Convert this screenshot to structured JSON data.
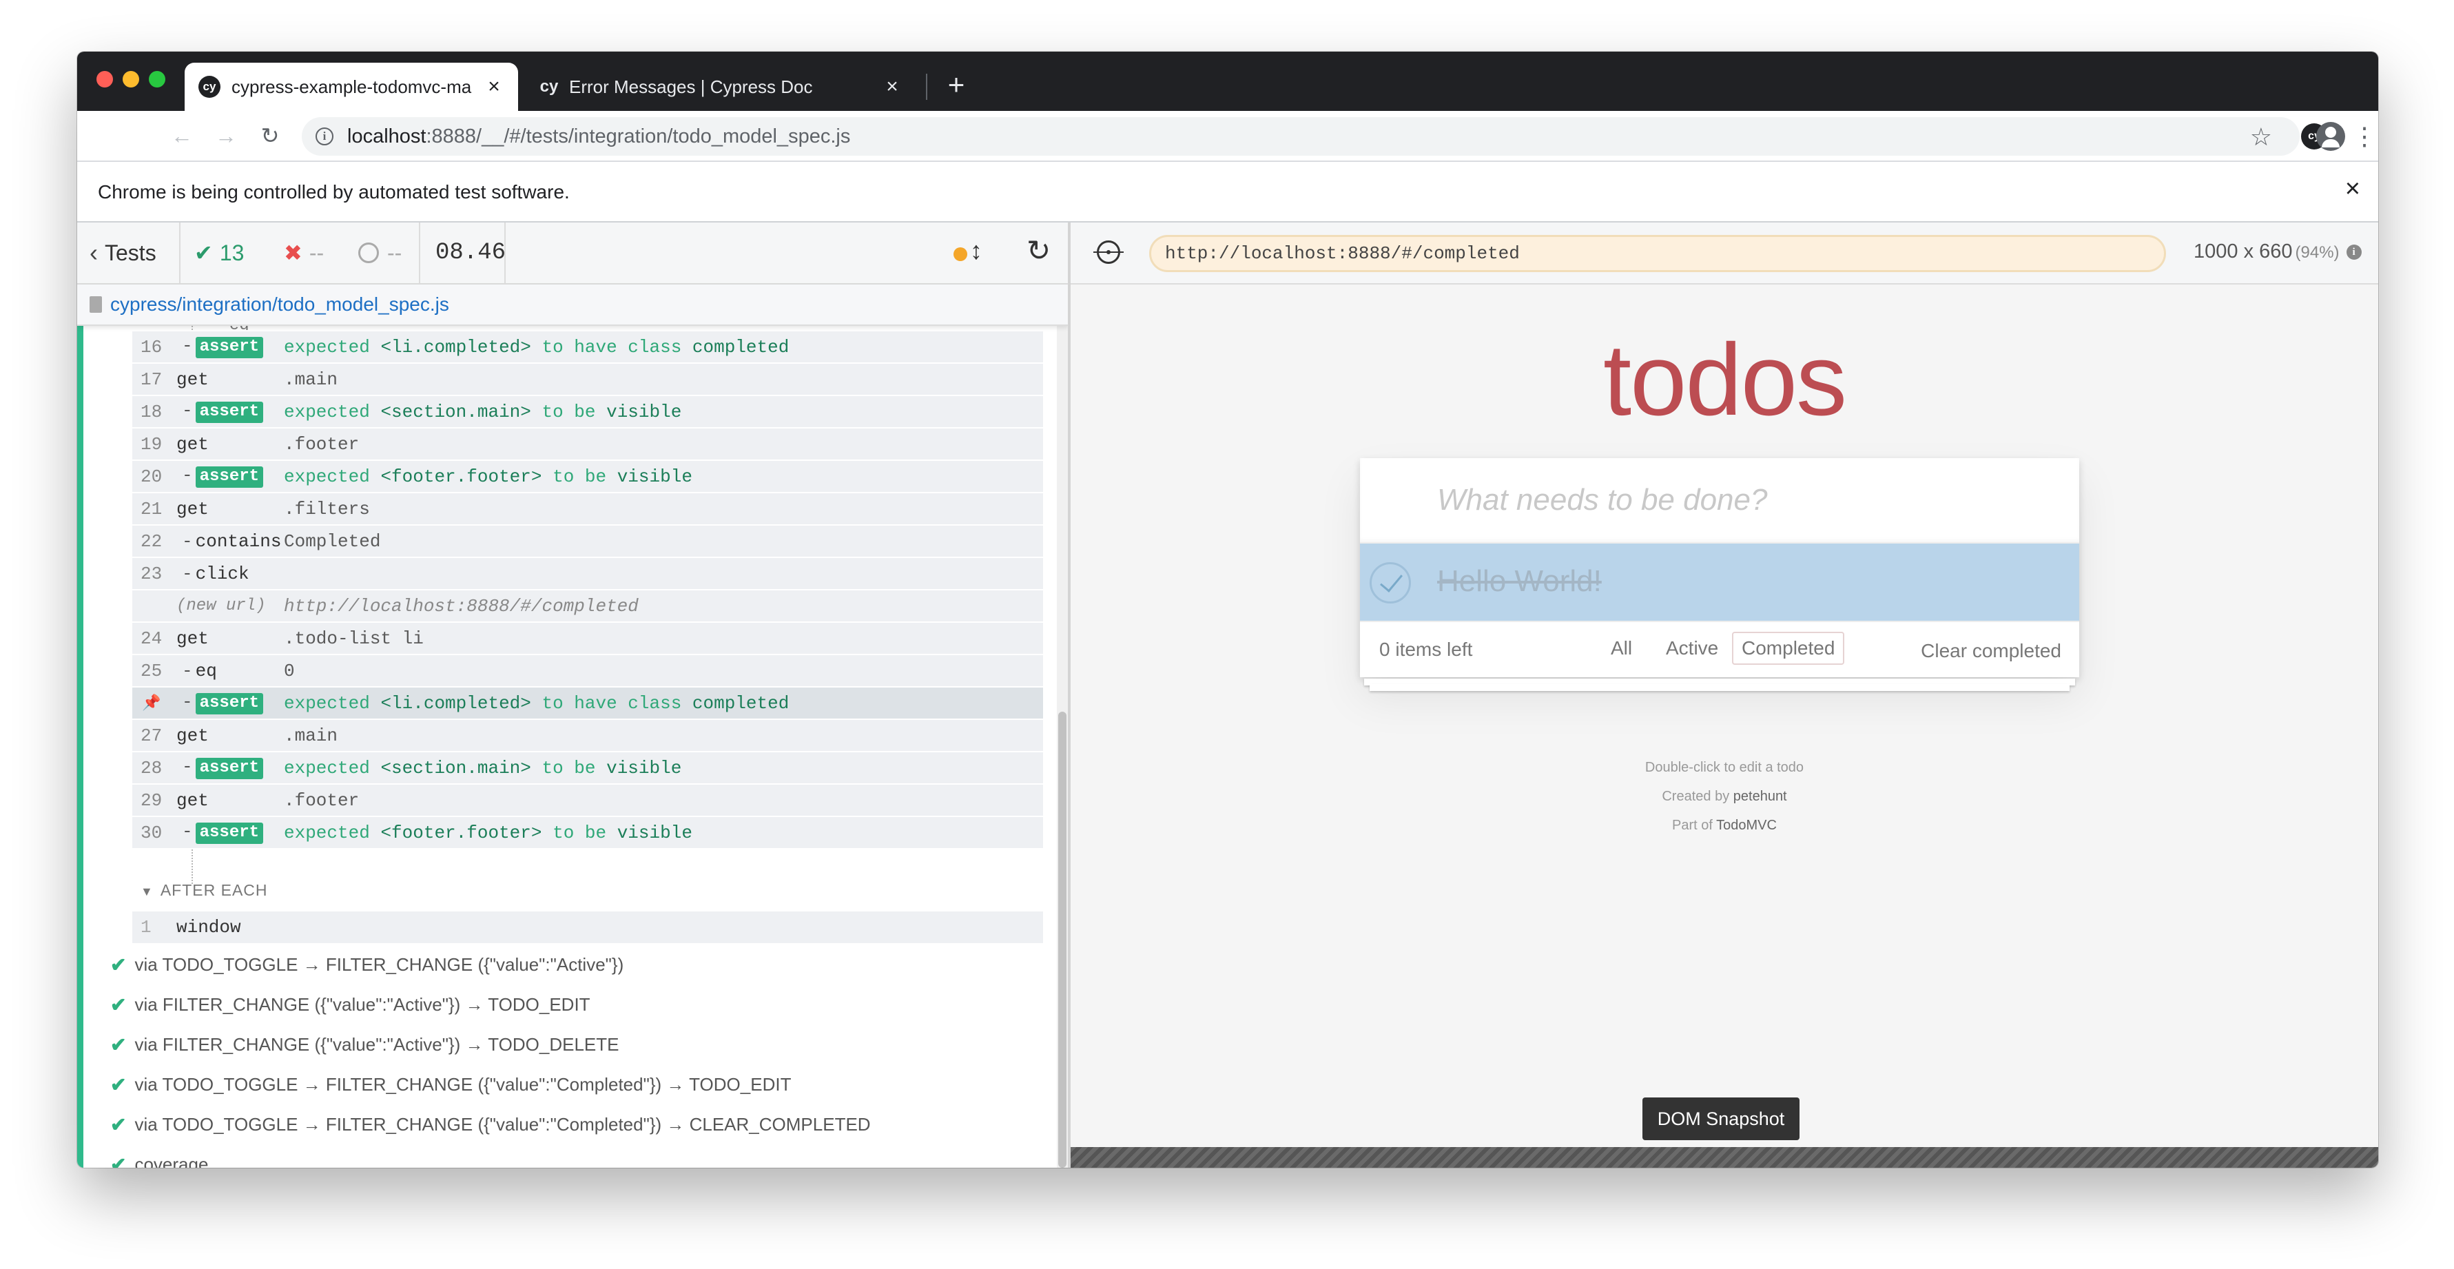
{
  "browser": {
    "tabs": [
      {
        "icon": "cy",
        "title": "cypress-example-todomvc-ma",
        "close": "×",
        "active": true
      },
      {
        "icon": "cy",
        "title": "Error Messages | Cypress Doc",
        "close": "×",
        "active": false
      }
    ],
    "new_tab": "+",
    "url_host": "localhost",
    "url_rest": ":8888/__/#/tests/integration/todo_model_spec.js",
    "ext_icon": "cy",
    "infobar_text": "Chrome is being controlled by automated test software.",
    "infobar_close": "×"
  },
  "reporter": {
    "tests_label": "Tests",
    "passed": "13",
    "failed": "--",
    "pending": "--",
    "duration": "08.46",
    "spec_path": "cypress/integration/todo_model_spec.js",
    "hint_row": "eq",
    "commands": [
      {
        "num": "16",
        "name": "assert",
        "child": true,
        "msg": "expected",
        "pre": "<li.completed>",
        "mid": "to have class",
        "post": "completed"
      },
      {
        "num": "17",
        "name": "get",
        "child": false,
        "msg": ".main"
      },
      {
        "num": "18",
        "name": "assert",
        "child": true,
        "msg": "expected",
        "pre": "<section.main>",
        "mid": "to be",
        "post": "visible"
      },
      {
        "num": "19",
        "name": "get",
        "child": false,
        "msg": ".footer"
      },
      {
        "num": "20",
        "name": "assert",
        "child": true,
        "msg": "expected",
        "pre": "<footer.footer>",
        "mid": "to be",
        "post": "visible"
      },
      {
        "num": "21",
        "name": "get",
        "child": false,
        "msg": ".filters"
      },
      {
        "num": "22",
        "name": "contains",
        "child": true,
        "msg": "Completed"
      },
      {
        "num": "23",
        "name": "click",
        "child": true,
        "msg": ""
      },
      {
        "num": "",
        "name": "(new url)",
        "child": false,
        "msg": "http://localhost:8888/#/completed",
        "newurl": true
      },
      {
        "num": "24",
        "name": "get",
        "child": false,
        "msg": ".todo-list li"
      },
      {
        "num": "25",
        "name": "eq",
        "child": true,
        "msg": "0"
      },
      {
        "num": "",
        "name": "assert",
        "child": true,
        "msg": "expected",
        "pre": "<li.completed>",
        "mid": "to have class",
        "post": "completed",
        "pinned": true
      },
      {
        "num": "27",
        "name": "get",
        "child": false,
        "msg": ".main"
      },
      {
        "num": "28",
        "name": "assert",
        "child": true,
        "msg": "expected",
        "pre": "<section.main>",
        "mid": "to be",
        "post": "visible"
      },
      {
        "num": "29",
        "name": "get",
        "child": false,
        "msg": ".footer"
      },
      {
        "num": "30",
        "name": "assert",
        "child": true,
        "msg": "expected",
        "pre": "<footer.footer>",
        "mid": "to be",
        "post": "visible"
      }
    ],
    "after_each_label": "AFTER EACH",
    "after_each_row": {
      "num": "1",
      "name": "window"
    },
    "tests": [
      "via TODO_TOGGLE → FILTER_CHANGE ({\"value\":\"Active\"})",
      "via FILTER_CHANGE ({\"value\":\"Active\"}) → TODO_EDIT",
      "via FILTER_CHANGE ({\"value\":\"Active\"}) → TODO_DELETE",
      "via TODO_TOGGLE → FILTER_CHANGE ({\"value\":\"Completed\"}) → TODO_EDIT",
      "via TODO_TOGGLE → FILTER_CHANGE ({\"value\":\"Completed\"}) → CLEAR_COMPLETED",
      "coverage"
    ]
  },
  "aut": {
    "url": "http://localhost:8888/#/completed",
    "viewport": "1000 x 660",
    "scale": "(94%)",
    "info_icon": "i",
    "app": {
      "title": "todos",
      "new_todo_placeholder": "What needs to be done?",
      "todo_item": "Hello World!",
      "items_left": "0 items left",
      "filters": [
        "All",
        "Active",
        "Completed"
      ],
      "clear_completed": "Clear completed",
      "info_lines": [
        "Double-click to edit a todo",
        "Created by",
        "petehunt",
        "Part of",
        "TodoMVC"
      ]
    },
    "dom_snapshot_label": "DOM Snapshot"
  },
  "colors": {
    "pass": "#2fb07f",
    "fail": "#e84e4e",
    "todos_title": "#b83f45",
    "completed_row": "#b9d4ea"
  }
}
